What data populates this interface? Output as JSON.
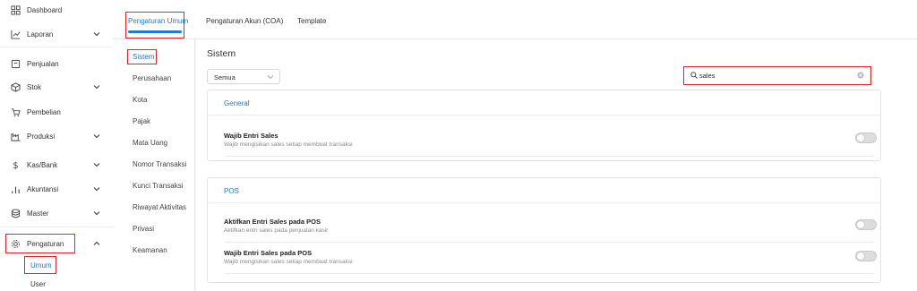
{
  "sidebar": {
    "items": [
      {
        "label": "Dashboard",
        "icon": "dashboard-icon"
      },
      {
        "label": "Laporan",
        "icon": "chart-line-icon"
      },
      {
        "label": "Penjualan",
        "icon": "invoice-icon"
      },
      {
        "label": "Stok",
        "icon": "box-icon"
      },
      {
        "label": "Pembelian",
        "icon": "cart-icon"
      },
      {
        "label": "Produksi",
        "icon": "factory-icon"
      },
      {
        "label": "Kas/Bank",
        "icon": "dollar-icon"
      },
      {
        "label": "Akuntansi",
        "icon": "bar-chart-icon"
      },
      {
        "label": "Master",
        "icon": "database-icon"
      },
      {
        "label": "Pengaturan",
        "icon": "gear-icon"
      }
    ],
    "sub_items": [
      {
        "label": "Umum"
      },
      {
        "label": "User"
      }
    ]
  },
  "tabs": [
    {
      "label": "Pengaturan Umum"
    },
    {
      "label": "Pengaturan Akun (COA)"
    },
    {
      "label": "Template"
    }
  ],
  "subnav": [
    {
      "label": "Sistem"
    },
    {
      "label": "Perusahaan"
    },
    {
      "label": "Kota"
    },
    {
      "label": "Pajak"
    },
    {
      "label": "Mata Uang"
    },
    {
      "label": "Nomor Transaksi"
    },
    {
      "label": "Kunci Transaksi"
    },
    {
      "label": "Riwayat Aktivitas"
    },
    {
      "label": "Privasi"
    },
    {
      "label": "Keamanan"
    }
  ],
  "content": {
    "title": "Sistem",
    "filter_value": "Semua",
    "search_value": "sales",
    "sections": [
      {
        "heading": "General",
        "settings": [
          {
            "title": "Wajib Entri Sales",
            "description": "Wajib mengisikan sales setiap membuat transaksi",
            "enabled": false
          }
        ]
      },
      {
        "heading": "POS",
        "settings": [
          {
            "title": "Aktifkan Entri Sales pada POS",
            "description": "Aktifkan entri sales pada penjualan kasir",
            "enabled": false
          },
          {
            "title": "Wajib Entri Sales pada POS",
            "description": "Wajib mengisikan sales setiap membuat transaksi",
            "enabled": false
          }
        ]
      }
    ]
  },
  "colors": {
    "accent": "#1f7ad6",
    "highlight": "#e0262b"
  }
}
